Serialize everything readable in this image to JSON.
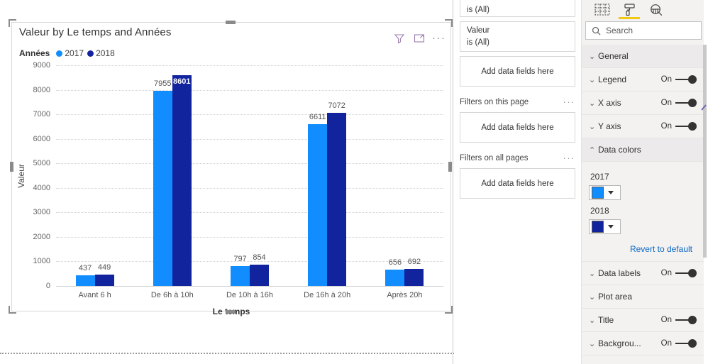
{
  "visual": {
    "title": "Valeur by Le temps and Années",
    "icons": {
      "filter": "filter-icon",
      "focus": "focus-mode-icon",
      "more": "···"
    },
    "legend_title": "Années",
    "xlabel": "Le temps",
    "ylabel": "Valeur"
  },
  "chart_data": {
    "type": "bar",
    "title": "Valeur by Le temps and Années",
    "xlabel": "Le temps",
    "ylabel": "Valeur",
    "categories": [
      "Avant 6 h",
      "De 6h à 10h",
      "De 10h à 16h",
      "De 16h à 20h",
      "Après 20h"
    ],
    "series": [
      {
        "name": "2017",
        "color": "#118DFF",
        "values": [
          437,
          7955,
          797,
          6611,
          656
        ]
      },
      {
        "name": "2018",
        "color": "#12239E",
        "values": [
          449,
          8601,
          854,
          7072,
          692
        ]
      }
    ],
    "ylim": [
      0,
      9000
    ],
    "yticks": [
      0,
      1000,
      2000,
      3000,
      4000,
      5000,
      6000,
      7000,
      8000,
      9000
    ],
    "grid": true,
    "legend_position": "top-left",
    "data_labels": true
  },
  "filters": {
    "cards": [
      {
        "name": "",
        "value": "is (All)",
        "clipped": true
      },
      {
        "name": "Valeur",
        "value": "is (All)",
        "clipped": false
      }
    ],
    "drop_visual": "Add data fields here",
    "page_section": "Filters on this page",
    "page_drop": "Add data fields here",
    "all_section": "Filters on all pages",
    "all_drop": "Add data fields here",
    "dots": "···"
  },
  "pane": {
    "tabs": [
      {
        "name": "fields",
        "icon": "fields-grid-icon",
        "active": false
      },
      {
        "name": "format",
        "icon": "paint-roller-icon",
        "active": true
      },
      {
        "name": "analytics",
        "icon": "analytics-magnifier-icon",
        "active": false
      }
    ],
    "search_placeholder": "Search",
    "sections": [
      {
        "label": "General",
        "toggle": null,
        "expanded": false,
        "shade": true
      },
      {
        "label": "Legend",
        "toggle": "On",
        "expanded": false,
        "shade": false
      },
      {
        "label": "X axis",
        "toggle": "On",
        "expanded": false,
        "shade": false
      },
      {
        "label": "Y axis",
        "toggle": "On",
        "expanded": false,
        "shade": false
      },
      {
        "label": "Data colors",
        "toggle": null,
        "expanded": true,
        "shade": true
      }
    ],
    "data_colors": {
      "items": [
        {
          "label": "2017",
          "color": "#118DFF"
        },
        {
          "label": "2018",
          "color": "#12239E"
        }
      ],
      "revert": "Revert to default"
    },
    "sections_after": [
      {
        "label": "Data labels",
        "toggle": "On",
        "shade": false
      },
      {
        "label": "Plot area",
        "toggle": null,
        "shade": false
      },
      {
        "label": "Title",
        "toggle": "On",
        "shade": false
      },
      {
        "label": "Backgrou...",
        "toggle": "On",
        "shade": false
      }
    ],
    "accent": "#f2c811"
  }
}
